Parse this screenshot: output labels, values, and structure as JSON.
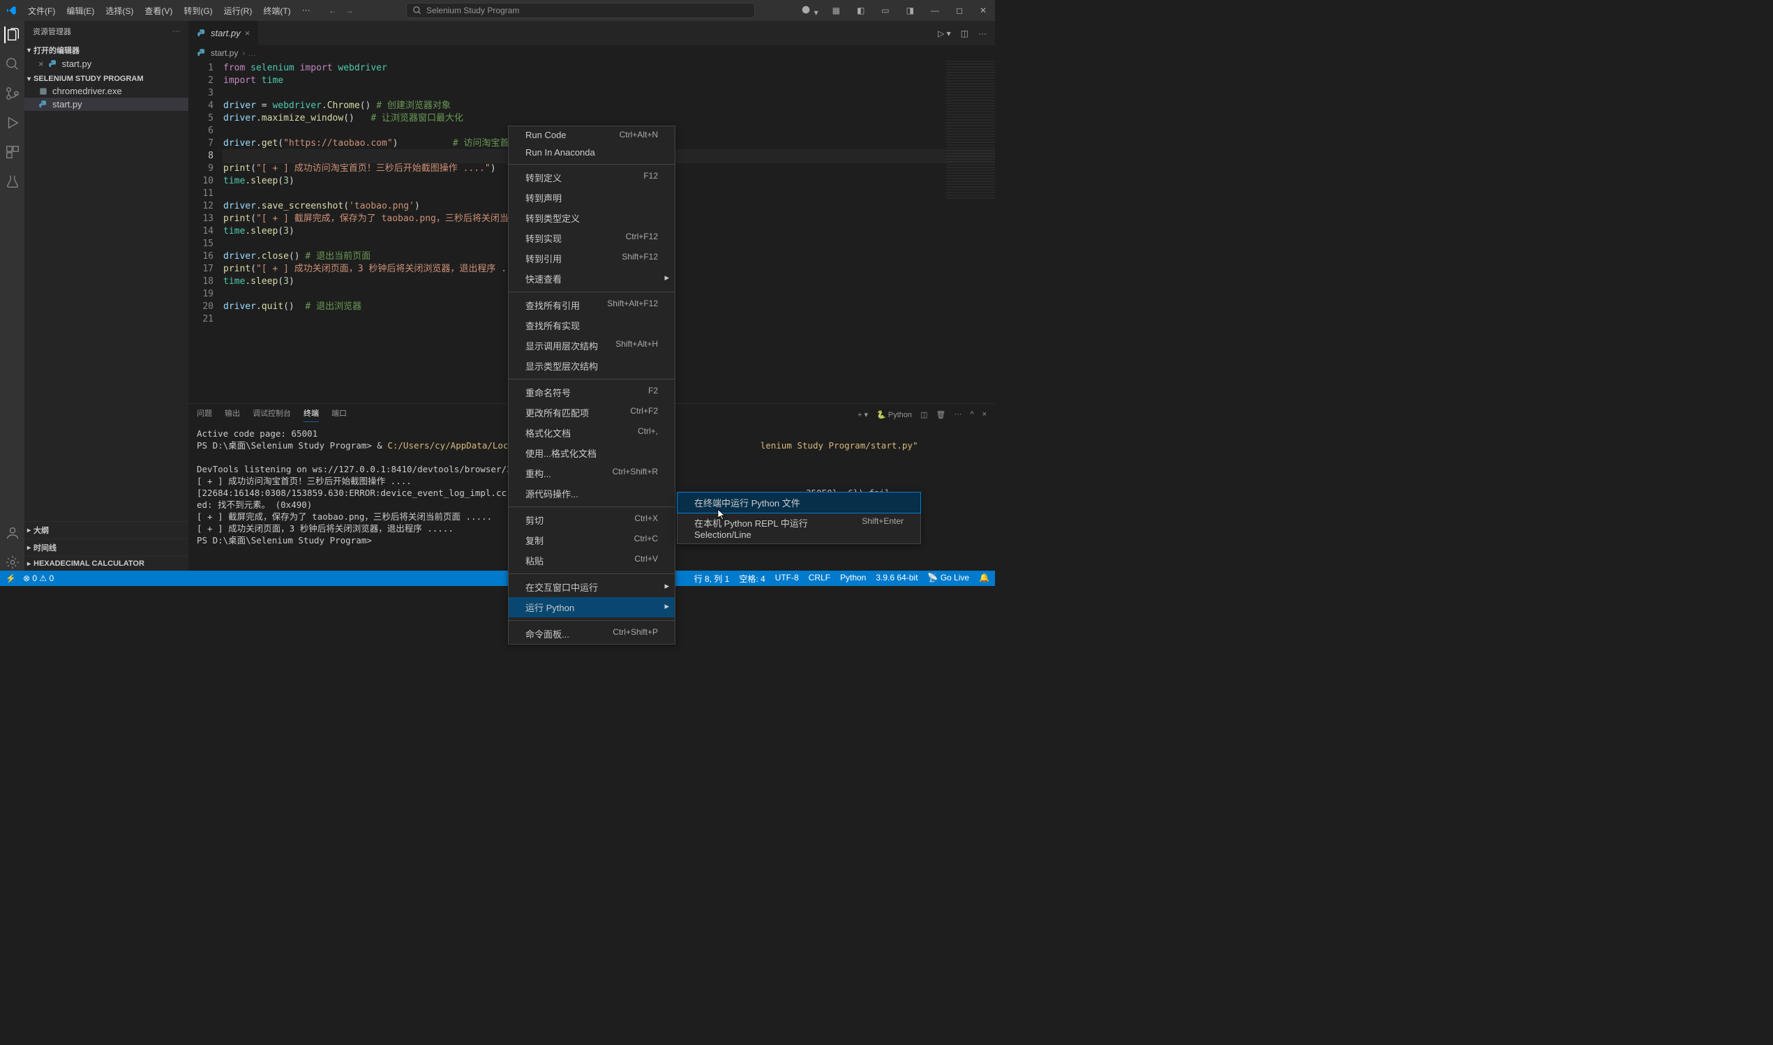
{
  "title": {
    "app_name": "Selenium Study Program"
  },
  "menubar": [
    "文件(F)",
    "编辑(E)",
    "选择(S)",
    "查看(V)",
    "转到(G)",
    "运行(R)",
    "终端(T)"
  ],
  "sidebar": {
    "title": "资源管理器",
    "open_editors": "打开的编辑器",
    "open_file": "start.py",
    "project": "SELENIUM STUDY PROGRAM",
    "files": [
      {
        "name": "chromedriver.exe",
        "kind": "exe"
      },
      {
        "name": "start.py",
        "kind": "py"
      }
    ],
    "collapsed": [
      "大纲",
      "时间线",
      "HEXADECIMAL CALCULATOR"
    ]
  },
  "tabs": {
    "active": "start.py"
  },
  "breadcrumbs": {
    "file": "start.py"
  },
  "editor": {
    "lines": [
      {
        "n": 1,
        "html": "<span class='kw'>from</span> <span class='mod'>selenium</span> <span class='kw'>import</span> <span class='mod'>webdriver</span>"
      },
      {
        "n": 2,
        "html": "<span class='kw'>import</span> <span class='mod'>time</span>"
      },
      {
        "n": 3,
        "html": ""
      },
      {
        "n": 4,
        "html": "<span class='var'>driver</span> <span class='pun'>=</span> <span class='mod'>webdriver</span><span class='pun'>.</span><span class='fn'>Chrome</span><span class='pun'>()</span> <span class='cmt'># 创建浏览器对象</span>"
      },
      {
        "n": 5,
        "html": "<span class='var'>driver</span><span class='pun'>.</span><span class='fn'>maximize_window</span><span class='pun'>()</span>   <span class='cmt'># 让浏览器窗口最大化</span>"
      },
      {
        "n": 6,
        "html": ""
      },
      {
        "n": 7,
        "html": "<span class='var'>driver</span><span class='pun'>.</span><span class='fn'>get</span><span class='pun'>(</span><span class='str'>\"https://taobao.com\"</span><span class='pun'>)</span>          <span class='cmt'># 访问淘宝首页</span>"
      },
      {
        "n": 8,
        "html": "",
        "current": true
      },
      {
        "n": 9,
        "html": "<span class='fn'>print</span><span class='pun'>(</span><span class='str'>\"[ + ] 成功访问淘宝首页！三秒后开始截图操作 ....\"</span><span class='pun'>)</span>"
      },
      {
        "n": 10,
        "html": "<span class='mod'>time</span><span class='pun'>.</span><span class='fn'>sleep</span><span class='pun'>(</span><span class='num'>3</span><span class='pun'>)</span>"
      },
      {
        "n": 11,
        "html": ""
      },
      {
        "n": 12,
        "html": "<span class='var'>driver</span><span class='pun'>.</span><span class='fn'>save_screenshot</span><span class='pun'>(</span><span class='str'>'taobao.png'</span><span class='pun'>)</span>"
      },
      {
        "n": 13,
        "html": "<span class='fn'>print</span><span class='pun'>(</span><span class='str'>\"[ + ] 截屏完成，保存为了 taobao.png，三秒后将关闭当前页面 .....\"</span><span class='pun'>)</span>"
      },
      {
        "n": 14,
        "html": "<span class='mod'>time</span><span class='pun'>.</span><span class='fn'>sleep</span><span class='pun'>(</span><span class='num'>3</span><span class='pun'>)</span>"
      },
      {
        "n": 15,
        "html": ""
      },
      {
        "n": 16,
        "html": "<span class='var'>driver</span><span class='pun'>.</span><span class='fn'>close</span><span class='pun'>()</span> <span class='cmt'># 退出当前页面</span>"
      },
      {
        "n": 17,
        "html": "<span class='fn'>print</span><span class='pun'>(</span><span class='str'>\"[ + ] 成功关闭页面，3 秒钟后将关闭浏览器，退出程序 .....\"</span><span class='pun'>)</span>"
      },
      {
        "n": 18,
        "html": "<span class='mod'>time</span><span class='pun'>.</span><span class='fn'>sleep</span><span class='pun'>(</span><span class='num'>3</span><span class='pun'>)</span>"
      },
      {
        "n": 19,
        "html": ""
      },
      {
        "n": 20,
        "html": "<span class='var'>driver</span><span class='pun'>.</span><span class='fn'>quit</span><span class='pun'>()</span>  <span class='cmt'># 退出浏览器</span>"
      },
      {
        "n": 21,
        "html": ""
      }
    ]
  },
  "panel": {
    "tabs": [
      "问题",
      "输出",
      "调试控制台",
      "终端",
      "端口"
    ],
    "active_tab": "终端",
    "right_kind": "Python",
    "terminal_lines": [
      "Active code page: 65001",
      "PS D:\\桌面\\Selenium Study Program> & <span class='y'>C:/Users/cy/AppData/Local/Programs/</span>                                    <span class='y'>lenium Study Program/start.py\"</span>",
      "",
      "DevTools listening on ws://127.0.0.1:8410/devtools/browser/388ab73e-6989",
      "[ + ] 成功访问淘宝首页！三秒后开始截图操作 ....",
      "[22684:16148:0308/153859.630:ERROR:device_event_log_impl.cc(202)] [15:38                                            350E0}, 6}) fail",
      "ed: 找不到元素。 (0x490)",
      "[ + ] 截屏完成，保存为了 taobao.png，三秒后将关闭当前页面 .....",
      "[ + ] 成功关闭页面，3 秒钟后将关闭浏览器，退出程序 .....",
      "PS D:\\桌面\\Selenium Study Program>"
    ]
  },
  "context_menu": {
    "items": [
      {
        "label": "Run Code",
        "shortcut": "Ctrl+Alt+N"
      },
      {
        "label": "Run In Anaconda"
      },
      {
        "sep": true
      },
      {
        "label": "转到定义",
        "shortcut": "F12"
      },
      {
        "label": "转到声明"
      },
      {
        "label": "转到类型定义"
      },
      {
        "label": "转到实现",
        "shortcut": "Ctrl+F12"
      },
      {
        "label": "转到引用",
        "shortcut": "Shift+F12"
      },
      {
        "label": "快速查看",
        "submenu": true
      },
      {
        "sep": true
      },
      {
        "label": "查找所有引用",
        "shortcut": "Shift+Alt+F12"
      },
      {
        "label": "查找所有实现"
      },
      {
        "label": "显示调用层次结构",
        "shortcut": "Shift+Alt+H"
      },
      {
        "label": "显示类型层次结构"
      },
      {
        "sep": true
      },
      {
        "label": "重命名符号",
        "shortcut": "F2"
      },
      {
        "label": "更改所有匹配项",
        "shortcut": "Ctrl+F2"
      },
      {
        "label": "格式化文档",
        "shortcut": "Ctrl+,"
      },
      {
        "label": "使用...格式化文档"
      },
      {
        "label": "重构...",
        "shortcut": "Ctrl+Shift+R"
      },
      {
        "label": "源代码操作..."
      },
      {
        "sep": true
      },
      {
        "label": "剪切",
        "shortcut": "Ctrl+X"
      },
      {
        "label": "复制",
        "shortcut": "Ctrl+C"
      },
      {
        "label": "粘贴",
        "shortcut": "Ctrl+V"
      },
      {
        "sep": true
      },
      {
        "label": "在交互窗口中运行",
        "submenu": true
      },
      {
        "label": "运行 Python",
        "submenu": true,
        "hl": true
      },
      {
        "sep": true
      },
      {
        "label": "命令面板...",
        "shortcut": "Ctrl+Shift+P"
      }
    ],
    "submenu": [
      {
        "label": "在终端中运行 Python 文件",
        "sel": true
      },
      {
        "label": "在本机 Python REPL 中运行 Selection/Line",
        "shortcut": "Shift+Enter"
      }
    ]
  },
  "statusbar": {
    "left": [],
    "right": [
      "行 8, 列 1",
      "空格: 4",
      "UTF-8",
      "CRLF",
      "Python",
      "3.9.6 64-bit",
      "Go Live"
    ]
  }
}
